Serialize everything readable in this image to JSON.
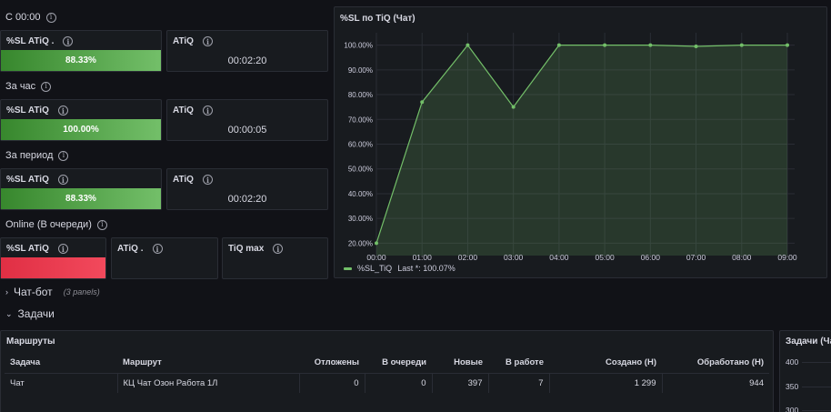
{
  "groups": [
    {
      "title": "С 00:00",
      "sl_title": "%SL ATiQ .",
      "sl_value": "88.33%",
      "atiq_title": "ATiQ",
      "atiq_value": "00:02:20"
    },
    {
      "title": "За час",
      "sl_title": "%SL ATiQ",
      "sl_value": "100.00%",
      "atiq_title": "ATiQ",
      "atiq_value": "00:00:05"
    },
    {
      "title": "За период",
      "sl_title": "%SL ATiQ",
      "sl_value": "88.33%",
      "atiq_title": "ATiQ",
      "atiq_value": "00:02:20"
    }
  ],
  "online": {
    "title": "Online (В очереди)",
    "sl_title": "%SL ATiQ",
    "atiq_title": "ATiQ .",
    "tiqmax_title": "TiQ max",
    "bar_color": "#e02f44"
  },
  "chart_panel": {
    "title": "%SL по TiQ (Чат)",
    "legend_series": "%SL_TiQ",
    "legend_stat": "Last *: 100.07%"
  },
  "chart_data": {
    "type": "area",
    "title": "%SL по TiQ (Чат)",
    "x": [
      "00:00",
      "01:00",
      "02:00",
      "03:00",
      "04:00",
      "05:00",
      "06:00",
      "07:00",
      "08:00",
      "09:00"
    ],
    "series": [
      {
        "name": "%SL_TiQ",
        "values": [
          20,
          77,
          100,
          75,
          100,
          100,
          100,
          99.5,
          100,
          100
        ]
      }
    ],
    "y_ticks": [
      "20.00%",
      "30.00%",
      "40.00%",
      "50.00%",
      "60.00%",
      "70.00%",
      "80.00%",
      "90.00%",
      "100.00%"
    ],
    "ylim": [
      15,
      105
    ],
    "grid": true,
    "legend": "bottom-left",
    "color": "#73bf69"
  },
  "rows": {
    "chatbot": {
      "label": "Чат-бот",
      "sub": "(3 panels)"
    },
    "tasks": {
      "label": "Задачи"
    }
  },
  "routes_panel": {
    "title": "Маршруты",
    "columns": [
      "Задача",
      "Маршрут",
      "Отложены",
      "В очереди",
      "Новые",
      "В работе",
      "Создано (Н)",
      "Обработано (Н)"
    ],
    "rows": [
      [
        "Чат",
        "КЦ Чат Озон Работа 1Л",
        "0",
        "0",
        "397",
        "7",
        "1 299",
        "944"
      ]
    ]
  },
  "tasks_chart_panel": {
    "title": "Задачи (Ча",
    "y_ticks": [
      "400",
      "350",
      "300"
    ]
  },
  "colors": {
    "background": "#111217",
    "panel": "#181b1f",
    "green": "#73bf69",
    "red": "#e02f44"
  }
}
